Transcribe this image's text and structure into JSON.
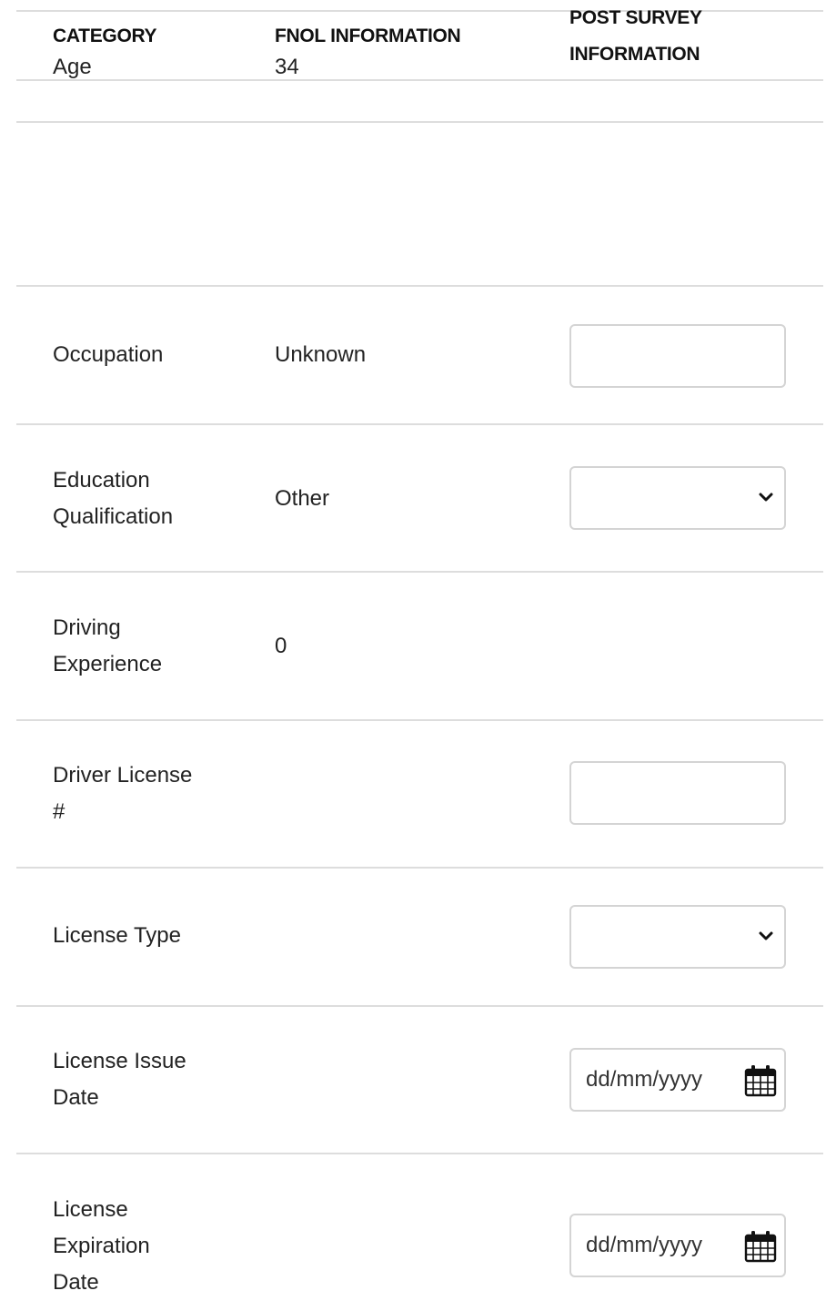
{
  "table": {
    "headers": {
      "category": "CATEGORY",
      "fnol": "FNOL INFORMATION",
      "post_survey": "POST SURVEY\nINFORMATION"
    },
    "rows": [
      {
        "category": "Age",
        "fnol": "34"
      },
      {
        "category": "Occupation",
        "fnol": "Unknown",
        "post_input": {
          "type": "text",
          "value": ""
        }
      },
      {
        "category": "Education\nQualification",
        "fnol": "Other",
        "post_input": {
          "type": "select",
          "value": ""
        }
      },
      {
        "category": "Driving\nExperience",
        "fnol": "0"
      },
      {
        "category": "Driver License\n#",
        "fnol": "",
        "post_input": {
          "type": "text",
          "value": ""
        }
      },
      {
        "category": "License Type",
        "fnol": "",
        "post_input": {
          "type": "select",
          "value": ""
        }
      },
      {
        "category": "License Issue\nDate",
        "fnol": "",
        "post_input": {
          "type": "date",
          "placeholder": "dd/mm/yyyy"
        }
      },
      {
        "category": "License\nExpiration\nDate",
        "fnol": "",
        "post_input": {
          "type": "date",
          "placeholder": "dd/mm/yyyy"
        }
      }
    ]
  },
  "icons": {
    "select": "chevron-down-icon",
    "date": "calendar-icon"
  },
  "colors": {
    "divider": "#dddddd",
    "field_border": "#d4d4d4",
    "text": "#222222"
  }
}
